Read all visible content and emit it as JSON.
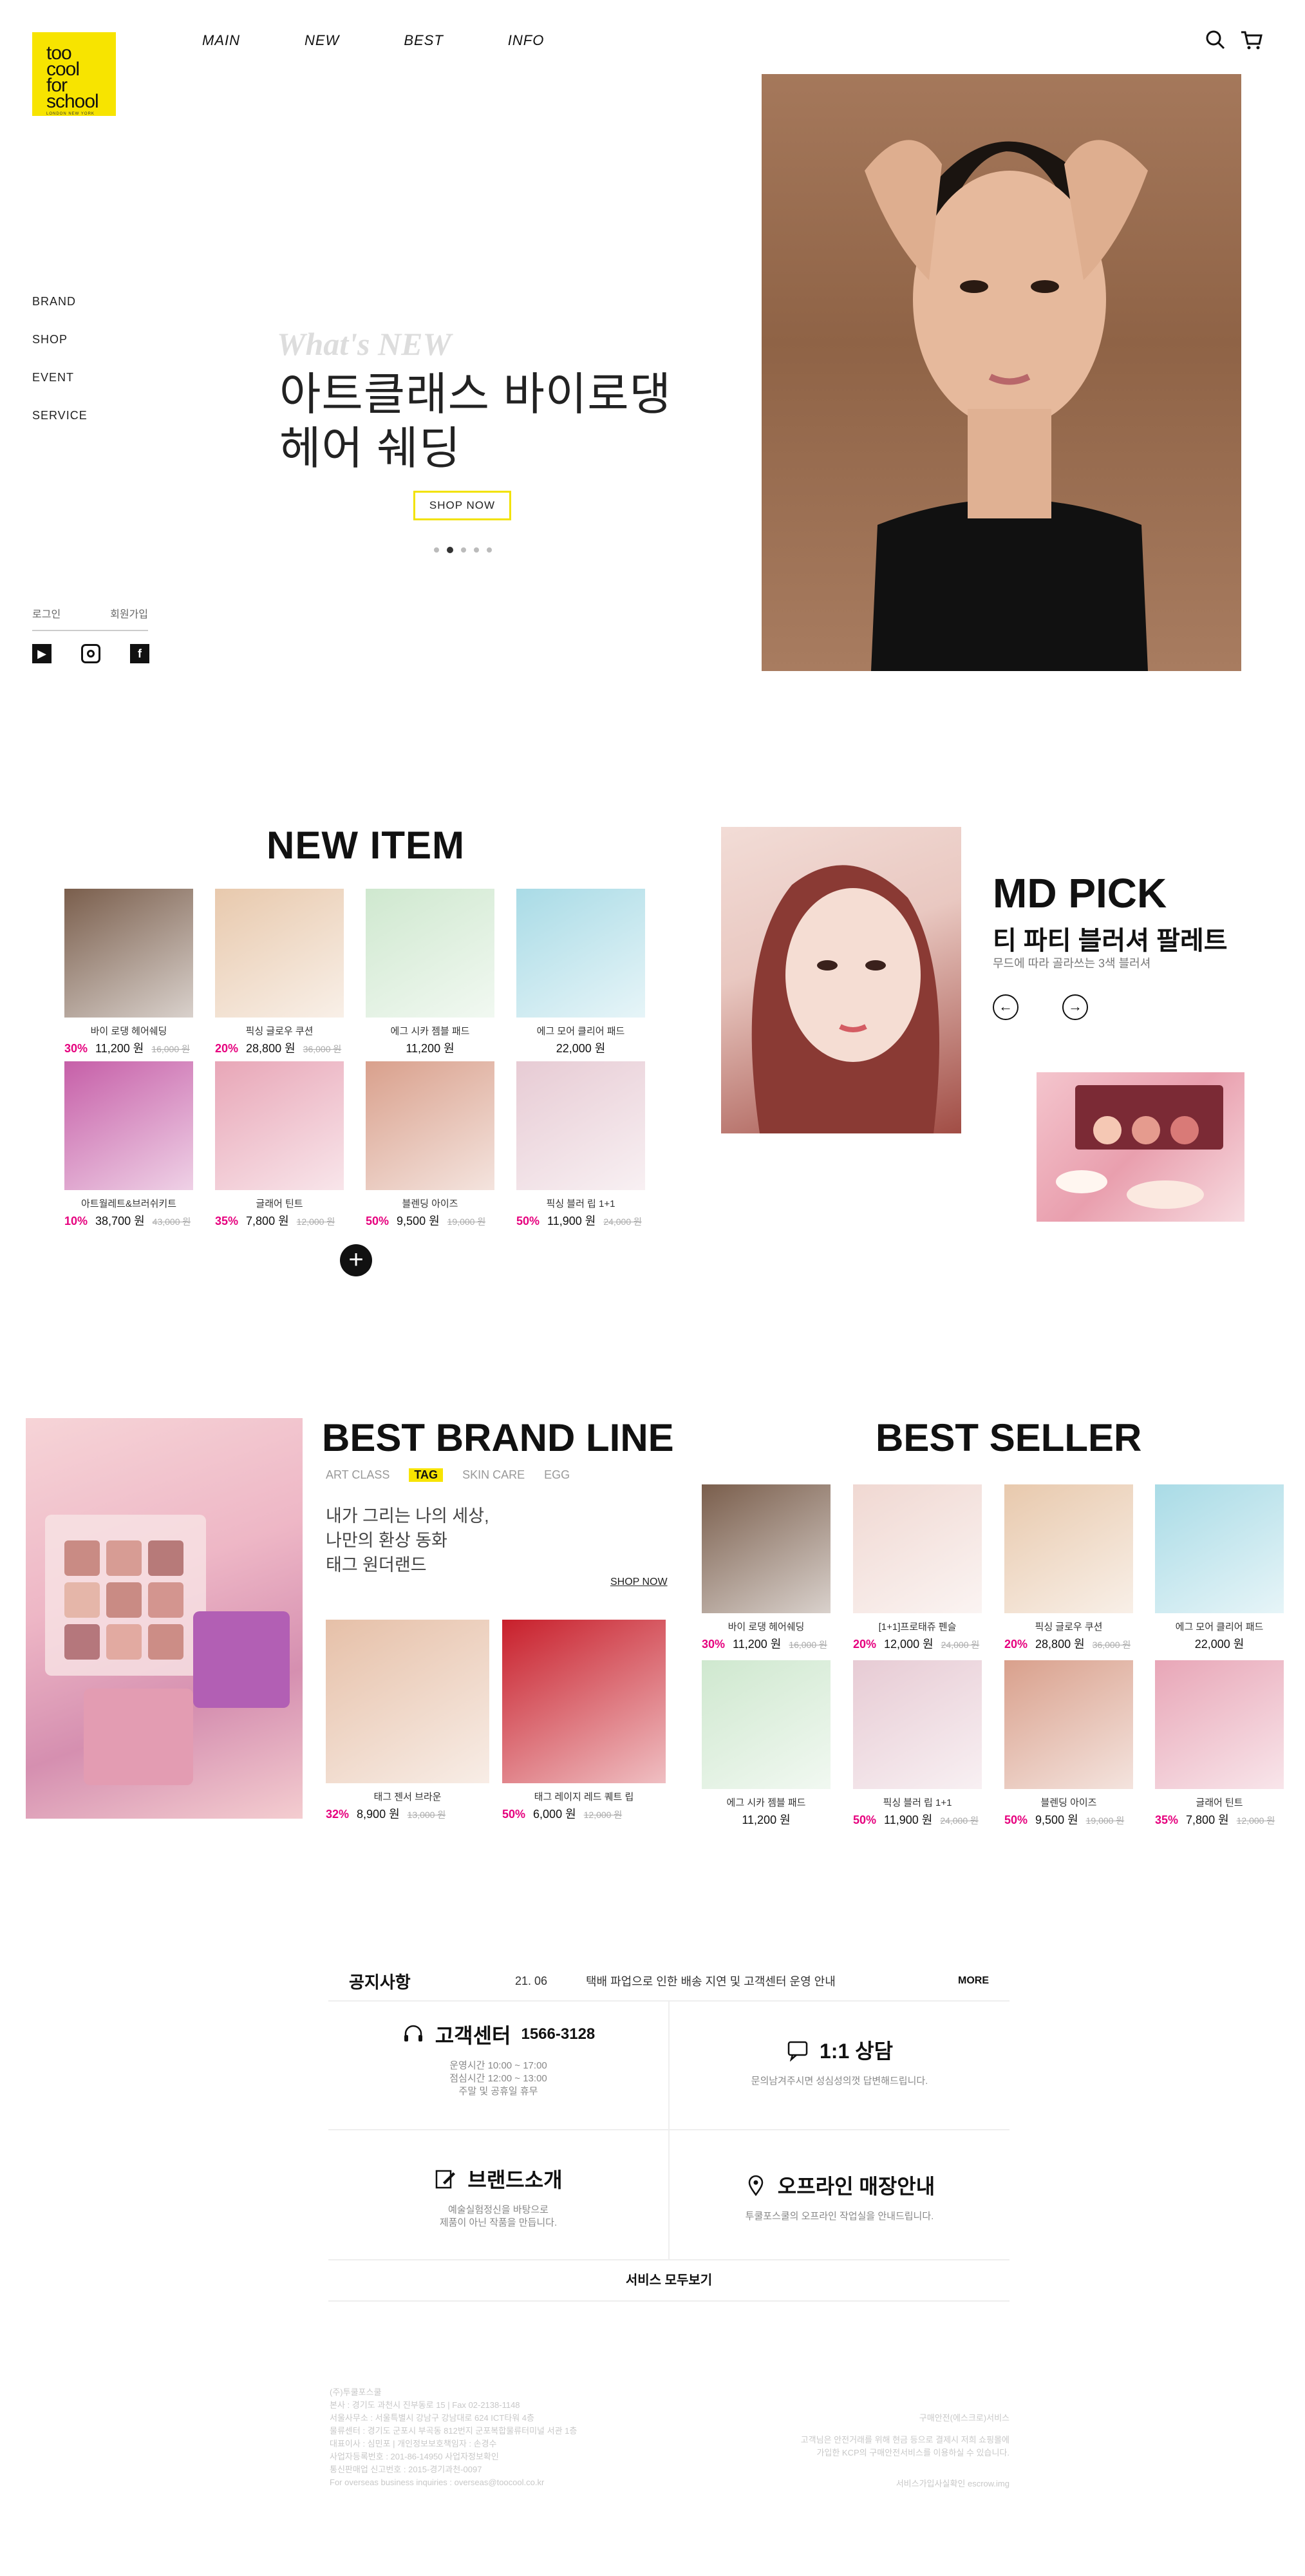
{
  "brand": {
    "logo_lines": [
      "too",
      "cool",
      "for",
      "school"
    ],
    "logo_sub": "LONDON NEW YORK",
    "accent": "#f7e400",
    "discount_color": "#e6007e"
  },
  "topnav": [
    "MAIN",
    "NEW",
    "BEST",
    "INFO"
  ],
  "sidenav": [
    "BRAND",
    "SHOP",
    "EVENT",
    "SERVICE"
  ],
  "auth": {
    "login": "로그인",
    "join": "회원가입"
  },
  "social": [
    "youtube-icon",
    "instagram-icon",
    "facebook-icon"
  ],
  "hero": {
    "whats_new": "What's NEW",
    "title_line1": "아트클래스 바이로댕",
    "title_line2": "헤어 쉐딩",
    "button": "SHOP NOW",
    "slides": 5,
    "active_slide": 2
  },
  "new_item": {
    "title": "NEW ITEM",
    "products": [
      {
        "name": "바이 로댕 헤어쉐딩",
        "disc": "30%",
        "price": "11,200 원",
        "old": "16,000 원",
        "color": "#7a5e4c"
      },
      {
        "name": "픽싱 글로우 쿠션",
        "disc": "20%",
        "price": "28,800 원",
        "old": "36,000 원",
        "color": "#e8c9ad"
      },
      {
        "name": "에그 시카 젬블 패드",
        "disc": "",
        "price": "11,200 원",
        "old": "",
        "color": "#cfe8cf"
      },
      {
        "name": "에그 모어 클리어 패드",
        "disc": "",
        "price": "22,000 원",
        "old": "",
        "color": "#a9dbe6"
      },
      {
        "name": "아트월레트&브러쉬키트",
        "disc": "10%",
        "price": "38,700 원",
        "old": "43,000 원",
        "color": "#c65fa8"
      },
      {
        "name": "글래어 틴트",
        "disc": "35%",
        "price": "7,800 원",
        "old": "12,000 원",
        "color": "#e8a6b7"
      },
      {
        "name": "블렌딩 아이즈",
        "disc": "50%",
        "price": "9,500 원",
        "old": "19,000 원",
        "color": "#d9a08c"
      },
      {
        "name": "픽싱 블러 립 1+1",
        "disc": "50%",
        "price": "11,900 원",
        "old": "24,000 원",
        "color": "#e7cbd4"
      }
    ],
    "more": "+"
  },
  "md_pick": {
    "title": "MD PICK",
    "subtitle": "티 파티 블러셔 팔레트",
    "desc": "무드에 따라 골라쓰는 3색 블러셔",
    "prev": "←",
    "next": "→"
  },
  "best_brand": {
    "title": "BEST BRAND LINE",
    "tabs": [
      "ART CLASS",
      "TAG",
      "SKIN CARE",
      "EGG"
    ],
    "active_tab": "TAG",
    "desc_line1": "내가 그리는 나의 세상,",
    "desc_line2": "나만의 환상 동화",
    "desc_line3": "태그 원더랜드",
    "shop_now": "SHOP NOW",
    "products": [
      {
        "name": "태그 젠서 브라운",
        "disc": "32%",
        "price": "8,900 원",
        "old": "13,000 원",
        "color": "#e6c0a8"
      },
      {
        "name": "태그 레이지 레드 퀘트 립",
        "disc": "50%",
        "price": "6,000 원",
        "old": "12,000 원",
        "color": "#c81f2b"
      }
    ]
  },
  "best_seller": {
    "title": "BEST SELLER",
    "products": [
      {
        "name": "바이 로댕 헤어쉐딩",
        "disc": "30%",
        "price": "11,200 원",
        "old": "16,000 원",
        "color": "#7a5e4c"
      },
      {
        "name": "[1+1]프로태쥬 펜슬",
        "disc": "20%",
        "price": "12,000 원",
        "old": "24,000 원",
        "color": "#f0d8d2"
      },
      {
        "name": "픽싱 글로우 쿠션",
        "disc": "20%",
        "price": "28,800 원",
        "old": "36,000 원",
        "color": "#e8c9ad"
      },
      {
        "name": "에그 모어 클리어 패드",
        "disc": "",
        "price": "22,000 원",
        "old": "",
        "color": "#a9dbe6"
      },
      {
        "name": "에그 시카 젬블 패드",
        "disc": "",
        "price": "11,200 원",
        "old": "",
        "color": "#cfe8cf"
      },
      {
        "name": "픽싱 블러 립 1+1",
        "disc": "50%",
        "price": "11,900 원",
        "old": "24,000 원",
        "color": "#e7cbd4"
      },
      {
        "name": "블렌딩 아이즈",
        "disc": "50%",
        "price": "9,500 원",
        "old": "19,000 원",
        "color": "#d9a08c"
      },
      {
        "name": "글래어 틴트",
        "disc": "35%",
        "price": "7,800 원",
        "old": "12,000 원",
        "color": "#e8a6b7"
      }
    ]
  },
  "notice": {
    "heading": "공지사항",
    "date": "21. 06",
    "text": "택배 파업으로 인한 배송 지연 및 고객센터 운영 안내",
    "more": "MORE"
  },
  "services": {
    "cs": {
      "title": "고객센터",
      "number": "1566-3128",
      "l1": "운영시간 10:00 ~ 17:00",
      "l2": "점심시간 12:00 ~ 13:00",
      "l3": "주말 및 공휴일 휴무"
    },
    "chat": {
      "title": "1:1 상담",
      "l1": "문의남겨주시면 성심성의껏 답변해드립니다."
    },
    "brand": {
      "title": "브랜드소개",
      "l1": "예술실험정신을 바탕으로",
      "l2": "제품이 아닌 작품을 만듭니다."
    },
    "store": {
      "title": "오프라인 매장안내",
      "l1": "투쿨포스쿨의 오프라인 작업실을 안내드립니다."
    },
    "all": "서비스 모두보기"
  },
  "footer": {
    "left": [
      "(주)투쿨포스쿨",
      "본사 : 경기도 과천시 진부동로 15 | Fax 02-2138-1148",
      "서울사무소 : 서울특별시 강남구 강남대로 624 ICT타워 4층",
      "물류센터 : 경기도 군포시 부곡동 812번지 군포복합물류터미널 서관 1층",
      "대표이사 : 심민포 | 개인정보보호책임자 : 손경수",
      "사업자등록번호 : 201-86-14950    사업자정보확인",
      "통신판매업 신고번호 : 2015-경기과천-0097",
      "For overseas business inquiries : overseas@toocool.co.kr"
    ],
    "right": [
      "구매안전(에스크로)서비스",
      "고객님은 안전거래를 위해 현금 등으로 결제시 저희 쇼핑몰에",
      "가입한 KCP의 구매안전서비스를 이용하실 수 있습니다.",
      "",
      "서비스가입사실확인 escrow.img"
    ]
  }
}
